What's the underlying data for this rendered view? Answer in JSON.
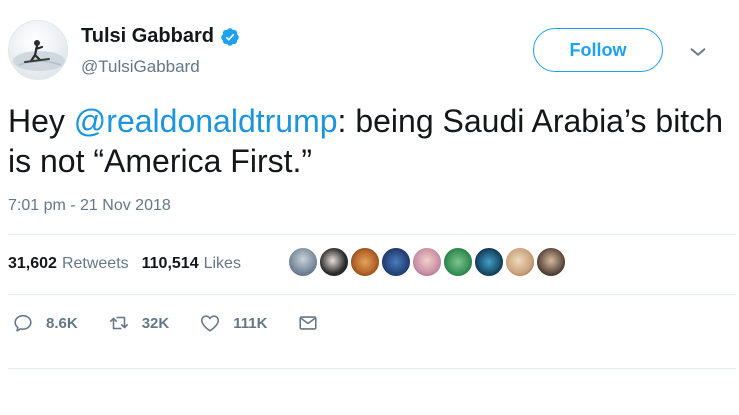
{
  "user": {
    "name": "Tulsi Gabbard",
    "handle": "@TulsiGabbard",
    "verified": true
  },
  "follow_button": {
    "label": "Follow"
  },
  "tweet": {
    "prefix": "Hey ",
    "mention": "@realdonaldtrump",
    "body": ": being Saudi Arabia’s bitch is not “America First.”",
    "timestamp": "7:01 pm - 21 Nov 2018"
  },
  "stats": {
    "retweets_count": "31,602",
    "retweets_label": "Retweets",
    "likes_count": "110,514",
    "likes_label": "Likes"
  },
  "likers": [
    {
      "name": "liker-1",
      "color": "#6a7a8c"
    },
    {
      "name": "liker-2",
      "color": "#2a2a2a"
    },
    {
      "name": "liker-3",
      "color": "#b5652a"
    },
    {
      "name": "liker-4",
      "color": "#1d3a6b"
    },
    {
      "name": "liker-5",
      "color": "#c98fa6"
    },
    {
      "name": "liker-6",
      "color": "#2f8a4f"
    },
    {
      "name": "liker-7",
      "color": "#123a55"
    },
    {
      "name": "liker-8",
      "color": "#c9a27a"
    },
    {
      "name": "liker-9",
      "color": "#4a3a30"
    }
  ],
  "actions": {
    "reply_count": "8.6K",
    "retweet_count": "32K",
    "like_count": "111K"
  },
  "colors": {
    "accent": "#1da1f2",
    "link": "#1b95e0",
    "muted": "#657786",
    "text": "#14171a",
    "divider": "#e6ecf0"
  },
  "icons": [
    "verified-badge-icon",
    "chevron-down-icon",
    "reply-icon",
    "retweet-icon",
    "heart-icon",
    "envelope-icon"
  ]
}
